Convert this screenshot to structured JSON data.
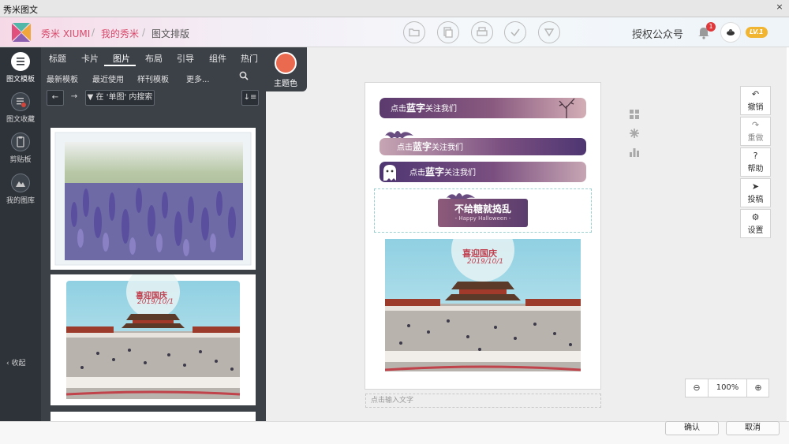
{
  "window": {
    "title": "秀米图文"
  },
  "header": {
    "breadcrumbs": [
      "秀米 XIUMI",
      "我的秀米",
      "图文排版"
    ],
    "auth_label": "授权公众号",
    "bell_badge": "1",
    "level_badge": "LV.1"
  },
  "rail": {
    "items": [
      {
        "label": "图文模板",
        "icon": "template-icon",
        "active": true
      },
      {
        "label": "图文收藏",
        "icon": "favorites-icon",
        "active": false
      },
      {
        "label": "剪贴板",
        "icon": "clipboard-icon",
        "active": false
      },
      {
        "label": "我的图库",
        "icon": "gallery-icon",
        "active": false
      }
    ],
    "collapse_label": "收起"
  },
  "tabs": [
    "标题",
    "卡片",
    "图片",
    "布局",
    "引导",
    "组件",
    "热门"
  ],
  "active_tab": "图片",
  "subtabs": [
    "最新模板",
    "最近使用",
    "样刊模板",
    "更多..."
  ],
  "theme": {
    "label": "主题色",
    "color": "#ea6a50"
  },
  "panel_toolbar": {
    "search_in": "在 '单图' 内搜索"
  },
  "cards": [
    {
      "alt": "lavender field"
    },
    {
      "title": "喜迎国庆",
      "date": "2019/10/1"
    }
  ],
  "page": {
    "pill1": {
      "prefix": "点击",
      "bold": "蓝字",
      "suffix": "关注我们"
    },
    "pill2": {
      "prefix": "点击",
      "bold": "蓝字",
      "suffix": "关注我们"
    },
    "pill3": {
      "prefix": "点击",
      "bold": "蓝字",
      "suffix": "关注我们"
    },
    "halloween": {
      "big": "不给糖就捣乱",
      "small": "- Happy Halloween -"
    },
    "poster": {
      "title": "喜迎国庆",
      "date": "2019/10/1"
    },
    "text_placeholder": "点击输入文字"
  },
  "right_tools": [
    {
      "label": "撤销",
      "icon": "undo-icon"
    },
    {
      "label": "重做",
      "icon": "redo-icon"
    },
    {
      "label": "帮助",
      "icon": "help-icon"
    },
    {
      "label": "投稿",
      "icon": "send-icon"
    },
    {
      "label": "设置",
      "icon": "settings-icon"
    }
  ],
  "zoom": {
    "value": "100%"
  },
  "footer": {
    "confirm": "确认",
    "cancel": "取消"
  }
}
